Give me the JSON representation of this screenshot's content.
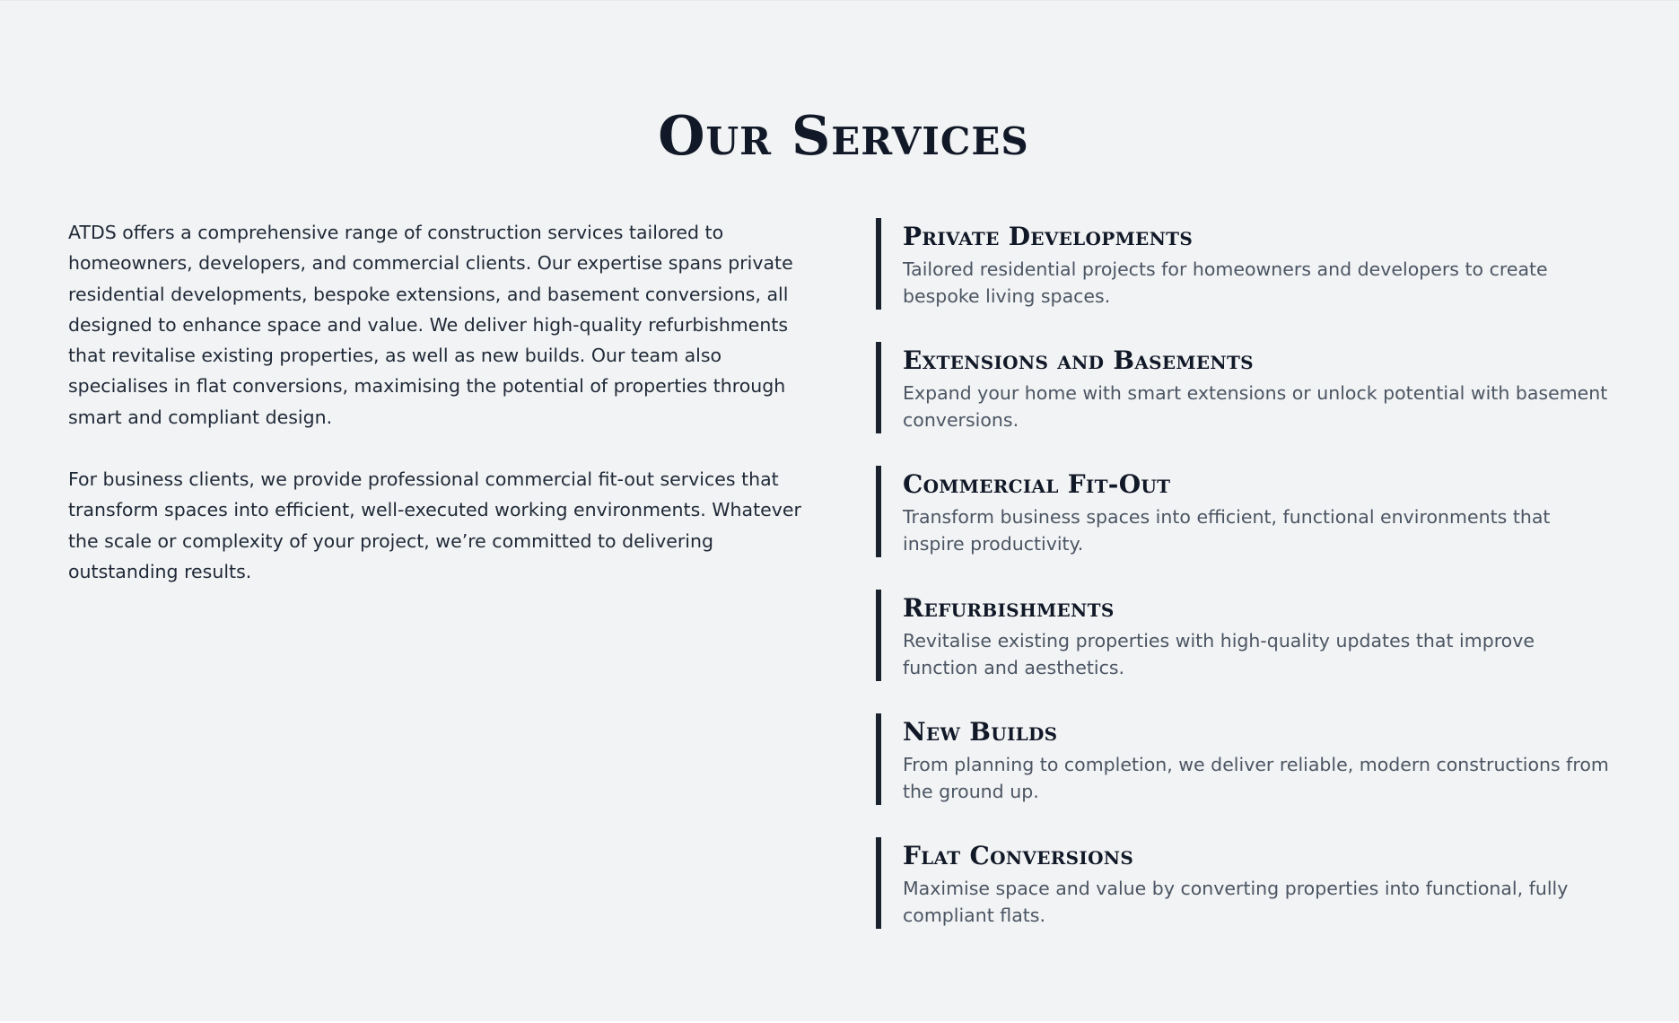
{
  "page": {
    "title": "Our Services",
    "intro_paragraphs": [
      "ATDS offers a comprehensive range of construction services tailored to homeowners, developers, and commercial clients. Our expertise spans private residential developments, bespoke extensions, and basement conversions, all designed to enhance space and value. We deliver high-quality refurbishments that revitalise existing properties, as well as new builds. Our team also specialises in flat conversions, maximising the potential of properties through smart and compliant design.",
      "For business clients, we provide professional commercial fit-out services that transform spaces into efficient, well-executed working environments. Whatever the scale or complexity of your project, we’re committed to delivering outstanding results."
    ]
  },
  "services": [
    {
      "title": "Private Developments",
      "description": "Tailored residential projects for homeowners and developers to create bespoke living spaces."
    },
    {
      "title": "Extensions and Basements",
      "description": "Expand your home with smart extensions or unlock potential with basement conversions."
    },
    {
      "title": "Commercial Fit-Out",
      "description": "Transform business spaces into efficient, functional environments that inspire productivity."
    },
    {
      "title": "Refurbishments",
      "description": "Revitalise existing properties with high-quality updates that improve function and aesthetics."
    },
    {
      "title": "New Builds",
      "description": "From planning to completion, we deliver reliable, modern constructions from the ground up."
    },
    {
      "title": "Flat Conversions",
      "description": "Maximise space and value by converting properties into functional, fully compliant flats."
    }
  ],
  "colors": {
    "section_background": "#f2f3f4",
    "heading": "#111827",
    "body_text": "#1f2937",
    "muted_text": "#4b5563",
    "accent_border": "#1a2230"
  }
}
